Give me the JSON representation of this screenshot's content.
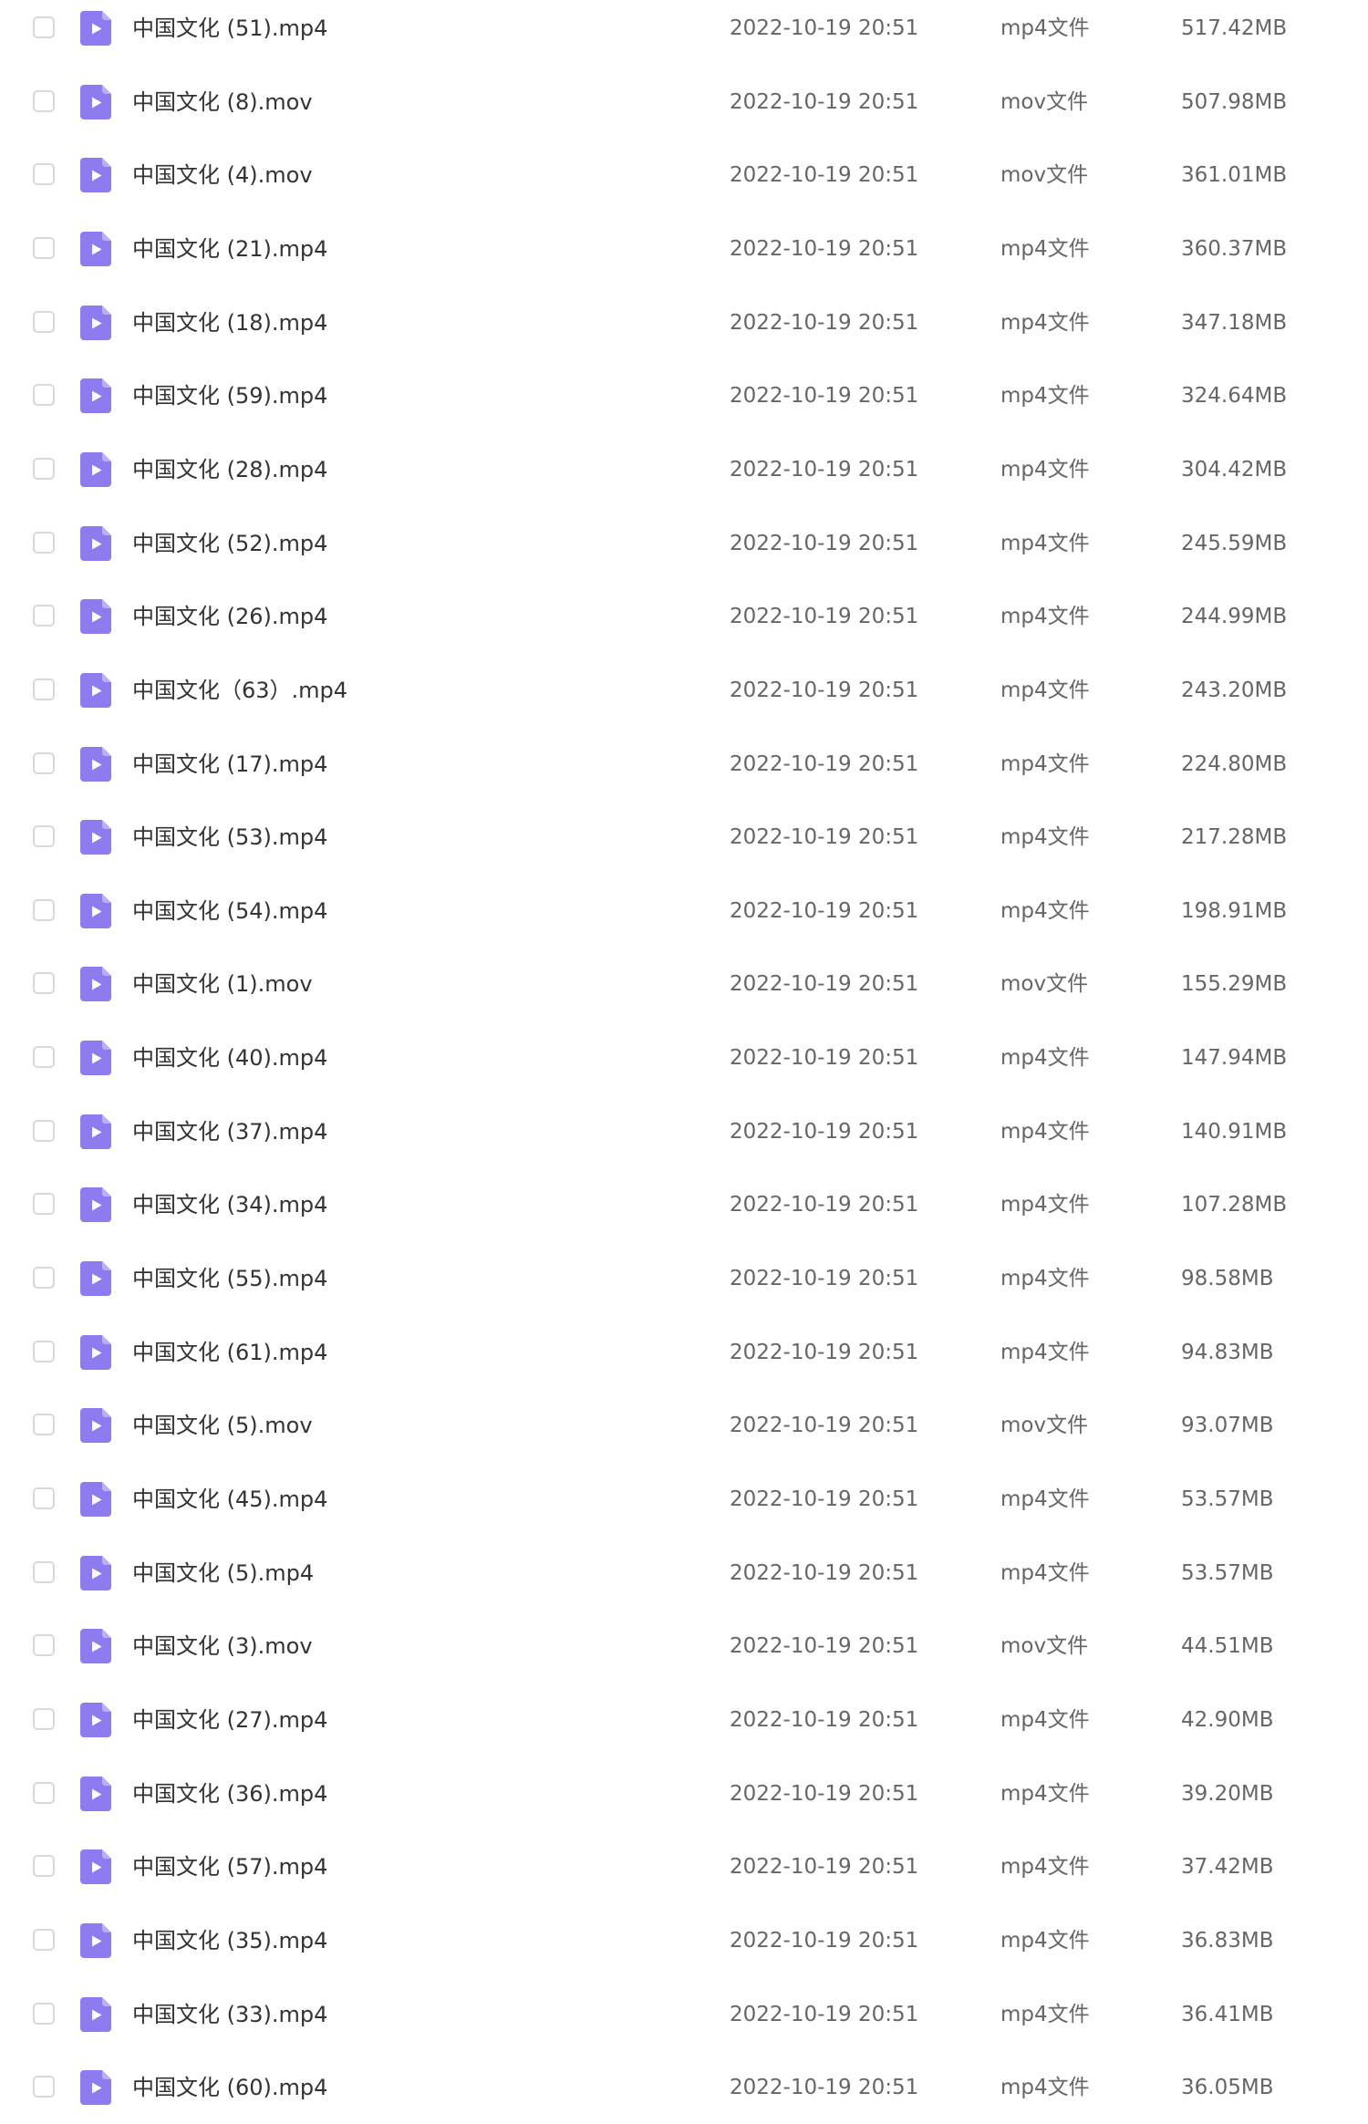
{
  "colors": {
    "icon_accent": "#8c7cf0",
    "icon_fold": "#b9aef7"
  },
  "file_icon_name": "video-file-icon",
  "files": [
    {
      "name": "中国文化 (51).mp4",
      "date": "2022-10-19 20:51",
      "type": "mp4文件",
      "size": "517.42MB"
    },
    {
      "name": "中国文化 (8).mov",
      "date": "2022-10-19 20:51",
      "type": "mov文件",
      "size": "507.98MB"
    },
    {
      "name": "中国文化 (4).mov",
      "date": "2022-10-19 20:51",
      "type": "mov文件",
      "size": "361.01MB"
    },
    {
      "name": "中国文化 (21).mp4",
      "date": "2022-10-19 20:51",
      "type": "mp4文件",
      "size": "360.37MB"
    },
    {
      "name": "中国文化 (18).mp4",
      "date": "2022-10-19 20:51",
      "type": "mp4文件",
      "size": "347.18MB"
    },
    {
      "name": "中国文化 (59).mp4",
      "date": "2022-10-19 20:51",
      "type": "mp4文件",
      "size": "324.64MB"
    },
    {
      "name": "中国文化 (28).mp4",
      "date": "2022-10-19 20:51",
      "type": "mp4文件",
      "size": "304.42MB"
    },
    {
      "name": "中国文化 (52).mp4",
      "date": "2022-10-19 20:51",
      "type": "mp4文件",
      "size": "245.59MB"
    },
    {
      "name": "中国文化 (26).mp4",
      "date": "2022-10-19 20:51",
      "type": "mp4文件",
      "size": "244.99MB"
    },
    {
      "name": "中国文化（63）.mp4",
      "date": "2022-10-19 20:51",
      "type": "mp4文件",
      "size": "243.20MB"
    },
    {
      "name": "中国文化 (17).mp4",
      "date": "2022-10-19 20:51",
      "type": "mp4文件",
      "size": "224.80MB"
    },
    {
      "name": "中国文化 (53).mp4",
      "date": "2022-10-19 20:51",
      "type": "mp4文件",
      "size": "217.28MB"
    },
    {
      "name": "中国文化 (54).mp4",
      "date": "2022-10-19 20:51",
      "type": "mp4文件",
      "size": "198.91MB"
    },
    {
      "name": "中国文化 (1).mov",
      "date": "2022-10-19 20:51",
      "type": "mov文件",
      "size": "155.29MB"
    },
    {
      "name": "中国文化 (40).mp4",
      "date": "2022-10-19 20:51",
      "type": "mp4文件",
      "size": "147.94MB"
    },
    {
      "name": "中国文化 (37).mp4",
      "date": "2022-10-19 20:51",
      "type": "mp4文件",
      "size": "140.91MB"
    },
    {
      "name": "中国文化 (34).mp4",
      "date": "2022-10-19 20:51",
      "type": "mp4文件",
      "size": "107.28MB"
    },
    {
      "name": "中国文化 (55).mp4",
      "date": "2022-10-19 20:51",
      "type": "mp4文件",
      "size": "98.58MB"
    },
    {
      "name": "中国文化 (61).mp4",
      "date": "2022-10-19 20:51",
      "type": "mp4文件",
      "size": "94.83MB"
    },
    {
      "name": "中国文化 (5).mov",
      "date": "2022-10-19 20:51",
      "type": "mov文件",
      "size": "93.07MB"
    },
    {
      "name": "中国文化 (45).mp4",
      "date": "2022-10-19 20:51",
      "type": "mp4文件",
      "size": "53.57MB"
    },
    {
      "name": "中国文化 (5).mp4",
      "date": "2022-10-19 20:51",
      "type": "mp4文件",
      "size": "53.57MB"
    },
    {
      "name": "中国文化 (3).mov",
      "date": "2022-10-19 20:51",
      "type": "mov文件",
      "size": "44.51MB"
    },
    {
      "name": "中国文化 (27).mp4",
      "date": "2022-10-19 20:51",
      "type": "mp4文件",
      "size": "42.90MB"
    },
    {
      "name": "中国文化 (36).mp4",
      "date": "2022-10-19 20:51",
      "type": "mp4文件",
      "size": "39.20MB"
    },
    {
      "name": "中国文化 (57).mp4",
      "date": "2022-10-19 20:51",
      "type": "mp4文件",
      "size": "37.42MB"
    },
    {
      "name": "中国文化 (35).mp4",
      "date": "2022-10-19 20:51",
      "type": "mp4文件",
      "size": "36.83MB"
    },
    {
      "name": "中国文化 (33).mp4",
      "date": "2022-10-19 20:51",
      "type": "mp4文件",
      "size": "36.41MB"
    },
    {
      "name": "中国文化 (60).mp4",
      "date": "2022-10-19 20:51",
      "type": "mp4文件",
      "size": "36.05MB"
    }
  ]
}
